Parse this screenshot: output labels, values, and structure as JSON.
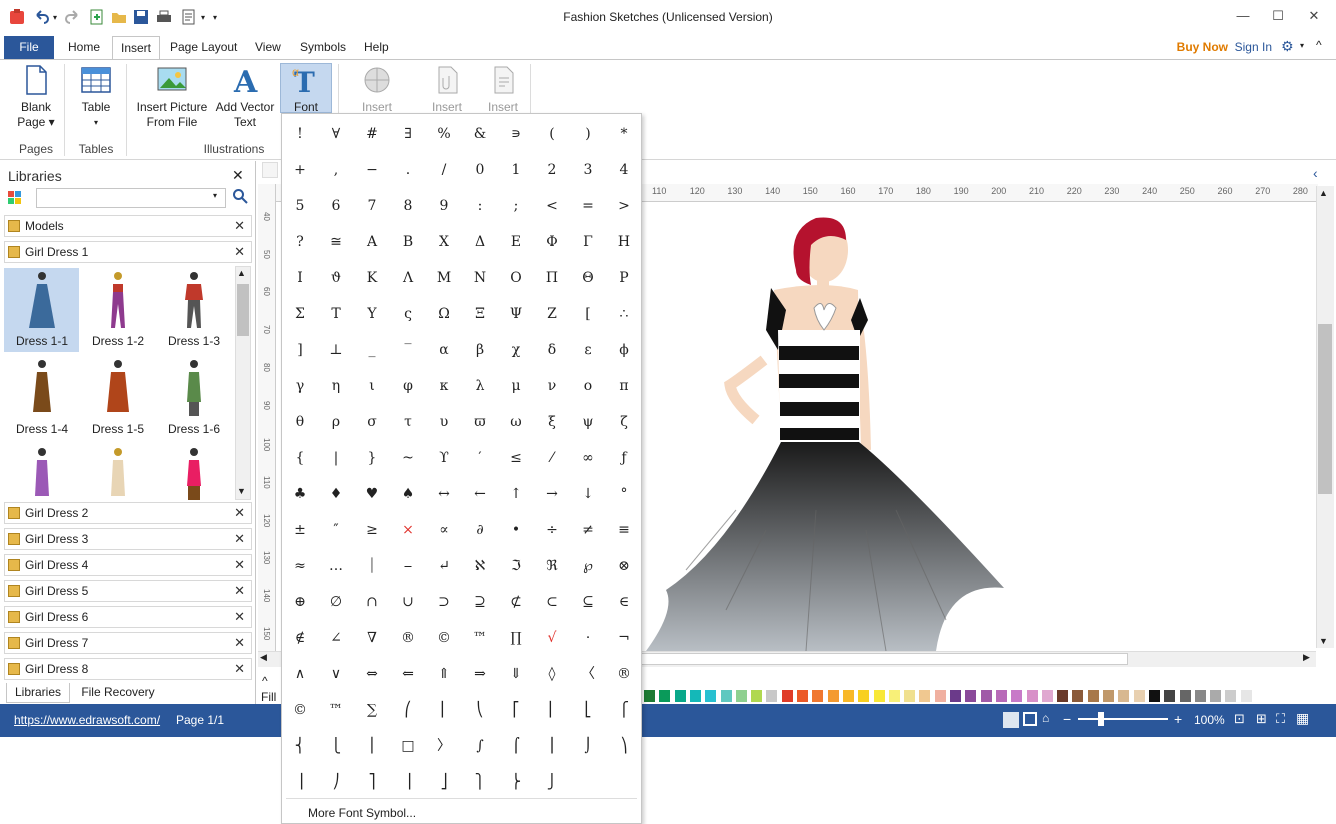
{
  "window": {
    "title": "Fashion Sketches (Unlicensed Version)"
  },
  "tabs": [
    "File",
    "Home",
    "Insert",
    "Page Layout",
    "View",
    "Symbols",
    "Help"
  ],
  "header": {
    "buy_now": "Buy Now",
    "sign_in": "Sign In"
  },
  "ribbon": {
    "blank_page": "Blank\nPage ▾",
    "table": "Table",
    "insert_picture": "Insert Picture\nFrom File",
    "add_vector_text": "Add Vector\nText",
    "font": "Font",
    "insert1": "Insert",
    "insert2": "Insert",
    "insert3": "Insert",
    "groups": {
      "pages": "Pages",
      "tables": "Tables",
      "illustrations": "Illustrations"
    }
  },
  "libraries": {
    "title": "Libraries",
    "search_placeholder": "",
    "models": "Models",
    "open_lib": "Girl Dress 1",
    "dresses": [
      "Dress 1-1",
      "Dress 1-2",
      "Dress 1-3",
      "Dress 1-4",
      "Dress 1-5",
      "Dress 1-6"
    ],
    "libs": [
      "Girl Dress 2",
      "Girl Dress 3",
      "Girl Dress 4",
      "Girl Dress 5",
      "Girl Dress 6",
      "Girl Dress 7",
      "Girl Dress 8"
    ],
    "bottom_tabs": [
      "Libraries",
      "File Recovery"
    ]
  },
  "ruler": {
    "ticks": [
      "110",
      "120",
      "130",
      "140",
      "150",
      "160",
      "170",
      "180",
      "190",
      "200",
      "210",
      "220",
      "230",
      "240",
      "250",
      "260",
      "270",
      "280"
    ],
    "vticks": [
      "40",
      "50",
      "60",
      "70",
      "80",
      "90",
      "100",
      "110",
      "120",
      "130",
      "140",
      "150"
    ]
  },
  "fill_label": "Fill",
  "status": {
    "url": "https://www.edrawsoft.com/",
    "page": "Page 1/1",
    "zoom": "100%"
  },
  "symbol_menu": {
    "symbols": [
      "!",
      "∀",
      "#",
      "∃",
      "%",
      "&",
      "∍",
      "(",
      ")",
      "*",
      "+",
      ",",
      "−",
      ".",
      "/",
      "0",
      "1",
      "2",
      "3",
      "4",
      "5",
      "6",
      "7",
      "8",
      "9",
      ":",
      ";",
      "<",
      "=",
      ">",
      "?",
      "≅",
      "Α",
      "Β",
      "Χ",
      "Δ",
      "Ε",
      "Φ",
      "Γ",
      "Η",
      "Ι",
      "ϑ",
      "Κ",
      "Λ",
      "Μ",
      "Ν",
      "Ο",
      "Π",
      "Θ",
      "Ρ",
      "Σ",
      "Τ",
      "Υ",
      "ς",
      "Ω",
      "Ξ",
      "Ψ",
      "Ζ",
      "[",
      "∴",
      "]",
      "⊥",
      "_",
      "‾",
      "α",
      "β",
      "χ",
      "δ",
      "ε",
      "ϕ",
      "γ",
      "η",
      "ι",
      "φ",
      "κ",
      "λ",
      "μ",
      "ν",
      "ο",
      "π",
      "θ",
      "ρ",
      "σ",
      "τ",
      "υ",
      "ϖ",
      "ω",
      "ξ",
      "ψ",
      "ζ",
      "{",
      "|",
      "}",
      "~",
      "ϒ",
      "′",
      "≤",
      "⁄",
      "∞",
      "ƒ",
      "♣",
      "♦",
      "♥",
      "♠",
      "↔",
      "←",
      "↑",
      "→",
      "↓",
      "°",
      "±",
      "″",
      "≥",
      "×",
      "∝",
      "∂",
      "•",
      "÷",
      "≠",
      "≡",
      "≈",
      "…",
      "⏐",
      "⎯",
      "↵",
      "ℵ",
      "ℑ",
      "ℜ",
      "℘",
      "⊗",
      "⊕",
      "∅",
      "∩",
      "∪",
      "⊃",
      "⊇",
      "⊄",
      "⊂",
      "⊆",
      "∈",
      "∉",
      "∠",
      "∇",
      "®",
      "©",
      "™",
      "∏",
      "√",
      "⋅",
      "¬",
      "∧",
      "∨",
      "⇔",
      "⇐",
      "⇑",
      "⇒",
      "⇓",
      "◊",
      "〈",
      "®",
      "©",
      "™",
      "∑",
      "⎛",
      "⎜",
      "⎝",
      "⎡",
      "⎢",
      "⎣",
      "⎧",
      "⎨",
      "⎩",
      "⎪",
      "□",
      "〉",
      "∫",
      "⌠",
      "⎮",
      "⌡",
      "⎞",
      "⎟",
      "⎠",
      "⎤",
      "⎥",
      "⎦",
      "⎫",
      "⎬",
      "⎭"
    ],
    "more": "More Font Symbol..."
  },
  "colors": {
    "accent": "#2b579a",
    "buy": "#e07b00"
  }
}
